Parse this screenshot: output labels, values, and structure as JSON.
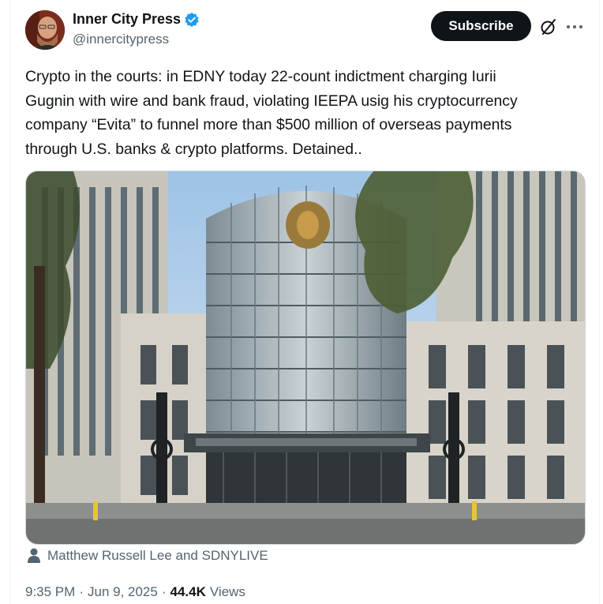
{
  "author": {
    "name": "Inner City Press",
    "handle": "@innercitypress",
    "verified_color": "#1d9bf0"
  },
  "actions": {
    "subscribe_label": "Subscribe",
    "grok_icon": "grok-icon",
    "more_icon": "more-icon"
  },
  "tweet": {
    "text": "Crypto in the courts: in EDNY today 22-count indictment charging Iurii\nGugnin with wire and bank fraud, violating IEEPA usig his cryptocurrency\ncompany “Evita” to funnel more than $500 million of overseas payments\nthrough U.S. banks & crypto platforms. Detained..",
    "image_alt": "UNITED STATES COURTHOUSE"
  },
  "media_credit": {
    "icon": "person-icon",
    "text": "Matthew Russell Lee and SDNYLIVE"
  },
  "meta": {
    "time": "9:35 PM",
    "separator": "·",
    "date": "Jun 9, 2025",
    "views_count": "44.4K",
    "views_label": "Views"
  },
  "colors": {
    "text_primary": "#0f1419",
    "text_secondary": "#536471",
    "button_bg": "#0f1419"
  }
}
